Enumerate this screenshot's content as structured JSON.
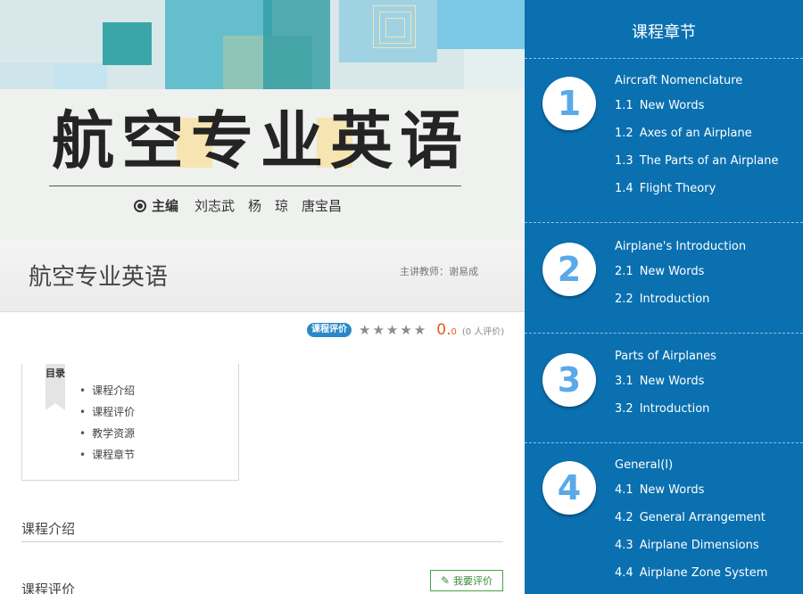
{
  "cover": {
    "title": "航空专业英语",
    "editor_label": "主编",
    "editors": "刘志武　杨　琼　唐宝昌"
  },
  "course": {
    "title": "航空专业英语",
    "teacher": "主讲教师：谢易成"
  },
  "rating": {
    "badge": "课程评价",
    "stars": "★★★★★",
    "score_main": "0.",
    "score_decimal": "0",
    "reviewers": "(0 人评价)"
  },
  "toc": {
    "tag": "目录",
    "items": [
      "课程介绍",
      "课程评价",
      "教学资源",
      "课程章节"
    ]
  },
  "sections": {
    "intro": "课程介绍",
    "review": "课程评价",
    "write_review": "我要评价"
  },
  "chapters_panel": {
    "title": "课程章节",
    "chapters": [
      {
        "number": "1",
        "title": "Aircraft Nomenclature",
        "items": [
          {
            "idx": "1.1",
            "label": "New Words"
          },
          {
            "idx": "1.2",
            "label": "Axes of an Airplane"
          },
          {
            "idx": "1.3",
            "label": "The Parts of an Airplane"
          },
          {
            "idx": "1.4",
            "label": "Flight Theory"
          }
        ]
      },
      {
        "number": "2",
        "title": "Airplane's Introduction",
        "items": [
          {
            "idx": "2.1",
            "label": "New Words"
          },
          {
            "idx": "2.2",
            "label": "Introduction"
          }
        ]
      },
      {
        "number": "3",
        "title": "Parts of Airplanes",
        "items": [
          {
            "idx": "3.1",
            "label": "New Words"
          },
          {
            "idx": "3.2",
            "label": "Introduction"
          }
        ]
      },
      {
        "number": "4",
        "title": "General(I)",
        "items": [
          {
            "idx": "4.1",
            "label": "New Words"
          },
          {
            "idx": "4.2",
            "label": "General Arrangement"
          },
          {
            "idx": "4.3",
            "label": "Airplane Dimensions"
          },
          {
            "idx": "4.4",
            "label": "Airplane Zone System"
          }
        ]
      }
    ]
  },
  "colors": {
    "panel_blue": "#0a70b0",
    "number_blue": "#5aa9e8",
    "score_orange": "#e8581c",
    "badge_blue": "#2b88c8"
  }
}
